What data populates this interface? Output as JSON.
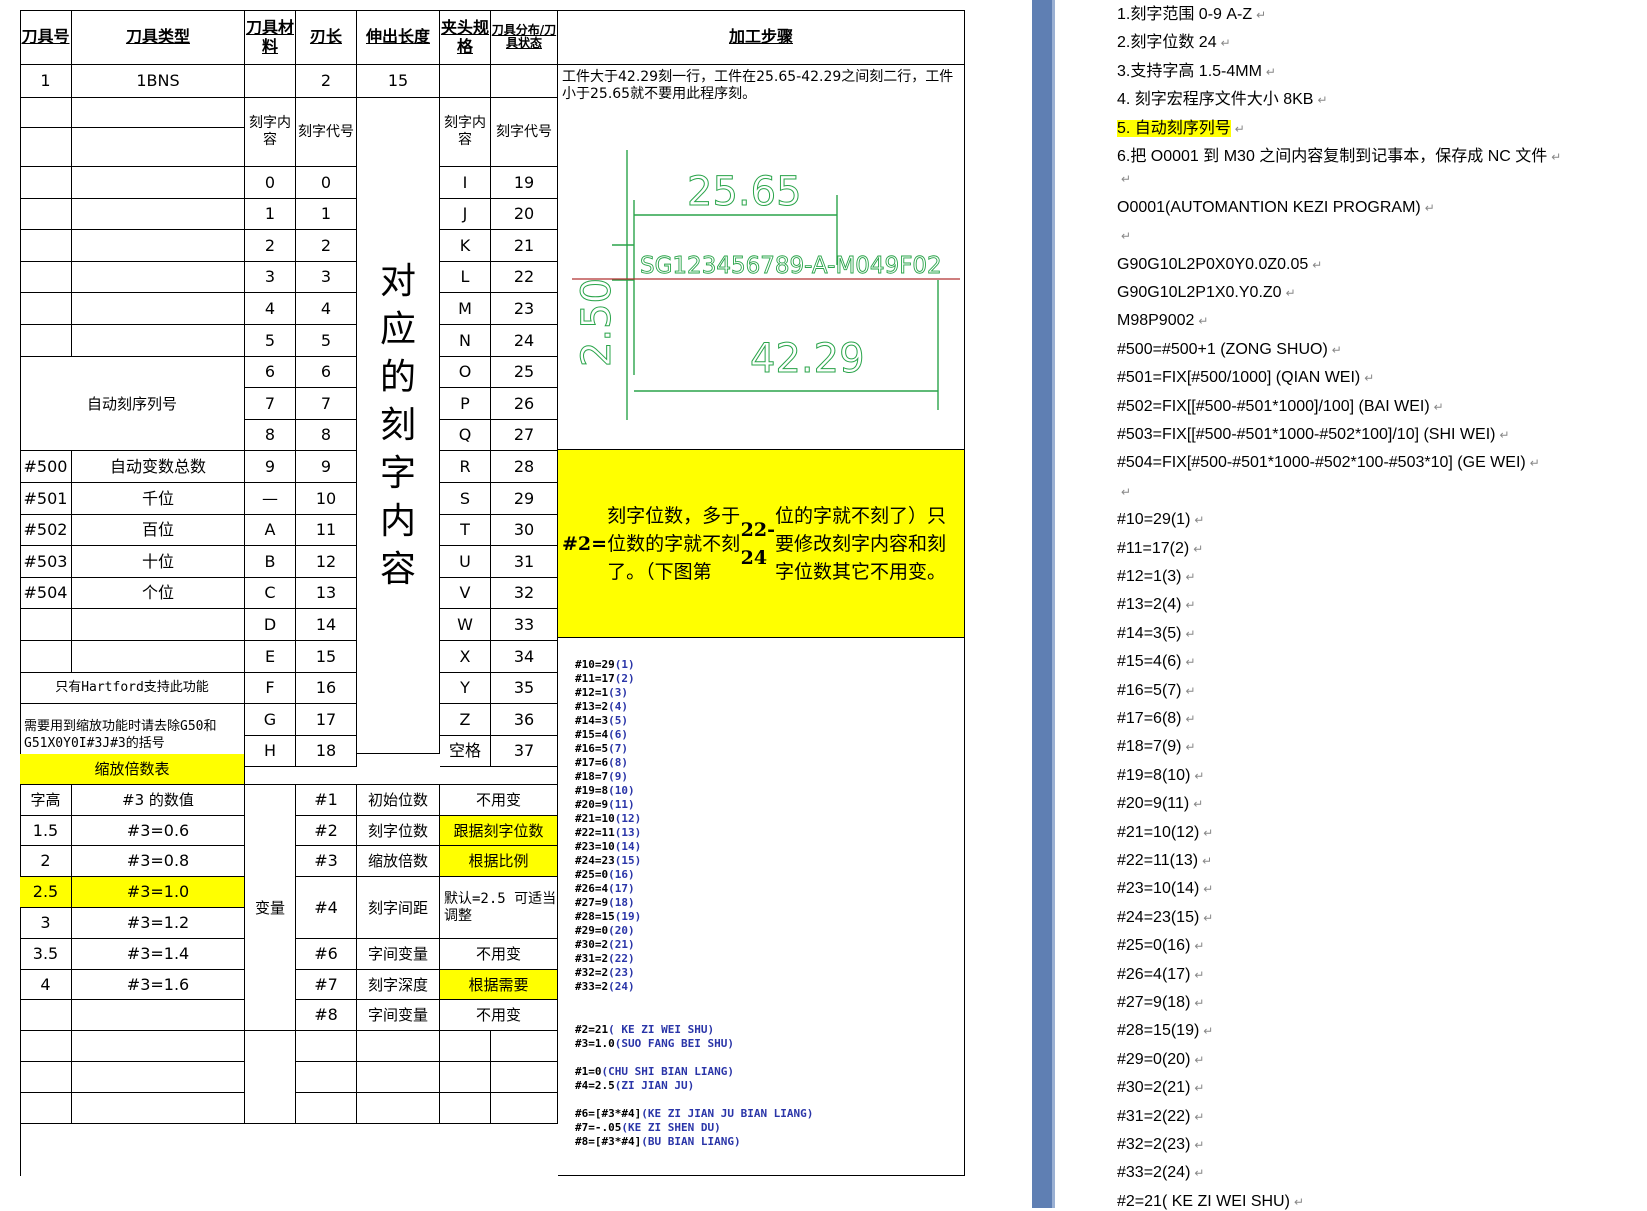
{
  "table": {
    "headers": {
      "tool_no": "刀具号",
      "tool_type": "刀具类型",
      "tool_material": "刀具材料",
      "blade_length": "刃长",
      "extension_length": "伸出长度",
      "chuck_spec": "夹头规格",
      "tool_dist": "刀具分布/刀具状态",
      "process_steps": "加工步骤"
    },
    "tool_row": {
      "no": "1",
      "type": "1BNS",
      "material": "",
      "blade": "2",
      "extension": "15"
    },
    "process_text": "工件大于42.29刻一行，工件在25.65-42.29之间刻二行，工件小于25.65就不要用此程序刻。",
    "col_content": "刻字内容",
    "col_code": "刻字代号",
    "big_vertical": "对应的刻字内容",
    "codes_left": [
      [
        "0",
        "0"
      ],
      [
        "1",
        "1"
      ],
      [
        "2",
        "2"
      ],
      [
        "3",
        "3"
      ],
      [
        "4",
        "4"
      ],
      [
        "5",
        "5"
      ],
      [
        "6",
        "6"
      ],
      [
        "7",
        "7"
      ],
      [
        "8",
        "8"
      ],
      [
        "9",
        "9"
      ],
      [
        "—",
        "10"
      ],
      [
        "A",
        "11"
      ],
      [
        "B",
        "12"
      ],
      [
        "C",
        "13"
      ],
      [
        "D",
        "14"
      ],
      [
        "E",
        "15"
      ],
      [
        "F",
        "16"
      ],
      [
        "G",
        "17"
      ],
      [
        "H",
        "18"
      ]
    ],
    "codes_right": [
      [
        "I",
        "19"
      ],
      [
        "J",
        "20"
      ],
      [
        "K",
        "21"
      ],
      [
        "L",
        "22"
      ],
      [
        "M",
        "23"
      ],
      [
        "N",
        "24"
      ],
      [
        "O",
        "25"
      ],
      [
        "P",
        "26"
      ],
      [
        "Q",
        "27"
      ],
      [
        "R",
        "28"
      ],
      [
        "S",
        "29"
      ],
      [
        "T",
        "30"
      ],
      [
        "U",
        "31"
      ],
      [
        "V",
        "32"
      ],
      [
        "W",
        "33"
      ],
      [
        "X",
        "34"
      ],
      [
        "Y",
        "35"
      ],
      [
        "Z",
        "36"
      ],
      [
        "空格",
        "37"
      ]
    ],
    "auto_serial": "自动刻序列号",
    "vars": [
      [
        "#500",
        "自动变数总数"
      ],
      [
        "#501",
        "千位"
      ],
      [
        "#502",
        "百位"
      ],
      [
        "#503",
        "十位"
      ],
      [
        "#504",
        "个位"
      ]
    ],
    "hartford_note": "只有Hartford支持此功能",
    "scale_note": "需要用到缩放功能时请去除G50和G51X0Y0I#3J#3的括号",
    "scale_table_title": "缩放倍数表",
    "scale_header": [
      "字高",
      "#3 的数值"
    ],
    "scale_rows": [
      [
        "1.5",
        "#3=0.6"
      ],
      [
        "2",
        "#3=0.8"
      ],
      [
        "2.5",
        "#3=1.0"
      ],
      [
        "3",
        "#3=1.2"
      ],
      [
        "3.5",
        "#3=1.4"
      ],
      [
        "4",
        "#3=1.6"
      ]
    ],
    "variable_label": "变量",
    "param_rows": [
      [
        "#1",
        "初始位数",
        "不用变"
      ],
      [
        "#2",
        "刻字位数",
        "跟据刻字位数"
      ],
      [
        "#3",
        "缩放倍数",
        "根据比例"
      ],
      [
        "#4",
        "刻字间距",
        "默认=2.5 可适当调整"
      ],
      [
        "#6",
        "字间变量",
        "不用变"
      ],
      [
        "#7",
        "刻字深度",
        "根据需要"
      ],
      [
        "#8",
        "字间变量",
        "不用变"
      ]
    ],
    "yellow_note_parts": [
      "#2=",
      "刻字位数，多于位数的字就不刻了。（下图第",
      "22-24",
      "位的字就不刻了）只要修改刻字内容和刻字位数其它不用变。"
    ],
    "drawing": {
      "dim_top": "25.65",
      "serial": "SG123456789-A-M049F02",
      "dim_left": "2.50",
      "dim_bottom": "42.29"
    },
    "code_lines": [
      [
        "#10=29",
        "(1)"
      ],
      [
        "#11=17",
        "(2)"
      ],
      [
        "#12=1",
        "(3)"
      ],
      [
        "#13=2",
        "(4)"
      ],
      [
        "#14=3",
        "(5)"
      ],
      [
        "#15=4",
        "(6)"
      ],
      [
        "#16=5",
        "(7)"
      ],
      [
        "#17=6",
        "(8)"
      ],
      [
        "#18=7",
        "(9)"
      ],
      [
        "#19=8",
        "(10)"
      ],
      [
        "#20=9",
        "(11)"
      ],
      [
        "#21=10",
        "(12)"
      ],
      [
        "#22=11",
        "(13)"
      ],
      [
        "#23=10",
        "(14)"
      ],
      [
        "#24=23",
        "(15)"
      ],
      [
        "#25=0",
        "(16)"
      ],
      [
        "#26=4",
        "(17)"
      ],
      [
        "#27=9",
        "(18)"
      ],
      [
        "#28=15",
        "(19)"
      ],
      [
        "#29=0",
        "(20)"
      ],
      [
        "#30=2",
        "(21)"
      ],
      [
        "#31=2",
        "(22)"
      ],
      [
        "#32=2",
        "(23)"
      ],
      [
        "#33=2",
        "(24)"
      ]
    ],
    "code_lines2": [
      [
        "#2=21",
        "( KE ZI WEI SHU)"
      ],
      [
        "#3=1.0",
        "(SUO FANG BEI SHU)"
      ],
      [
        "#1=0",
        "(CHU SHI BIAN LIANG)"
      ],
      [
        "#4=2.5",
        "(ZI JIAN JU)"
      ],
      [
        "#6=[#3*#4]",
        "(KE ZI JIAN JU BIAN LIANG)"
      ],
      [
        "#7=-.05",
        "(KE ZI SHEN DU)"
      ],
      [
        "#8=[#3*#4]",
        "(BU BIAN LIANG)"
      ]
    ]
  },
  "right_doc": {
    "lines": [
      "1.刻字范围 0-9 A-Z",
      "2.刻字位数 24",
      "3.支持字高 1.5-4MM",
      "4. 刻字宏程序文件大小 8KB",
      "5. 自动刻序列号",
      "6.把 O0001 到 M30 之间内容复制到记事本，保存成 NC 文件",
      "",
      "O0001(AUTOMANTION KEZI PROGRAM)",
      "",
      "G90G10L2P0X0Y0.0Z0.05",
      "G90G10L2P1X0.Y0.Z0",
      "M98P9002",
      "#500=#500+1 (ZONG SHUO)",
      "#501=FIX[#500/1000] (QIAN WEI)",
      "#502=FIX[[#500-#501*1000]/100] (BAI WEI)",
      "#503=FIX[[#500-#501*1000-#502*100]/10] (SHI WEI)",
      "#504=FIX[#500-#501*1000-#502*100-#503*10] (GE WEI)",
      "",
      "#10=29(1)",
      "#11=17(2)",
      "#12=1(3)",
      "#13=2(4)",
      "#14=3(5)",
      "#15=4(6)",
      "#16=5(7)",
      "#17=6(8)",
      "#18=7(9)",
      "#19=8(10)",
      "#20=9(11)",
      "#21=10(12)",
      "#22=11(13)",
      "#23=10(14)",
      "#24=23(15)",
      "#25=0(16)",
      "#26=4(17)",
      "#27=9(18)",
      "#28=15(19)",
      "#29=0(20)",
      "#30=2(21)",
      "#31=2(22)",
      "#32=2(23)",
      "#33=2(24)",
      "#2=21( KE ZI WEI SHU)"
    ],
    "para_mark": "↵"
  }
}
